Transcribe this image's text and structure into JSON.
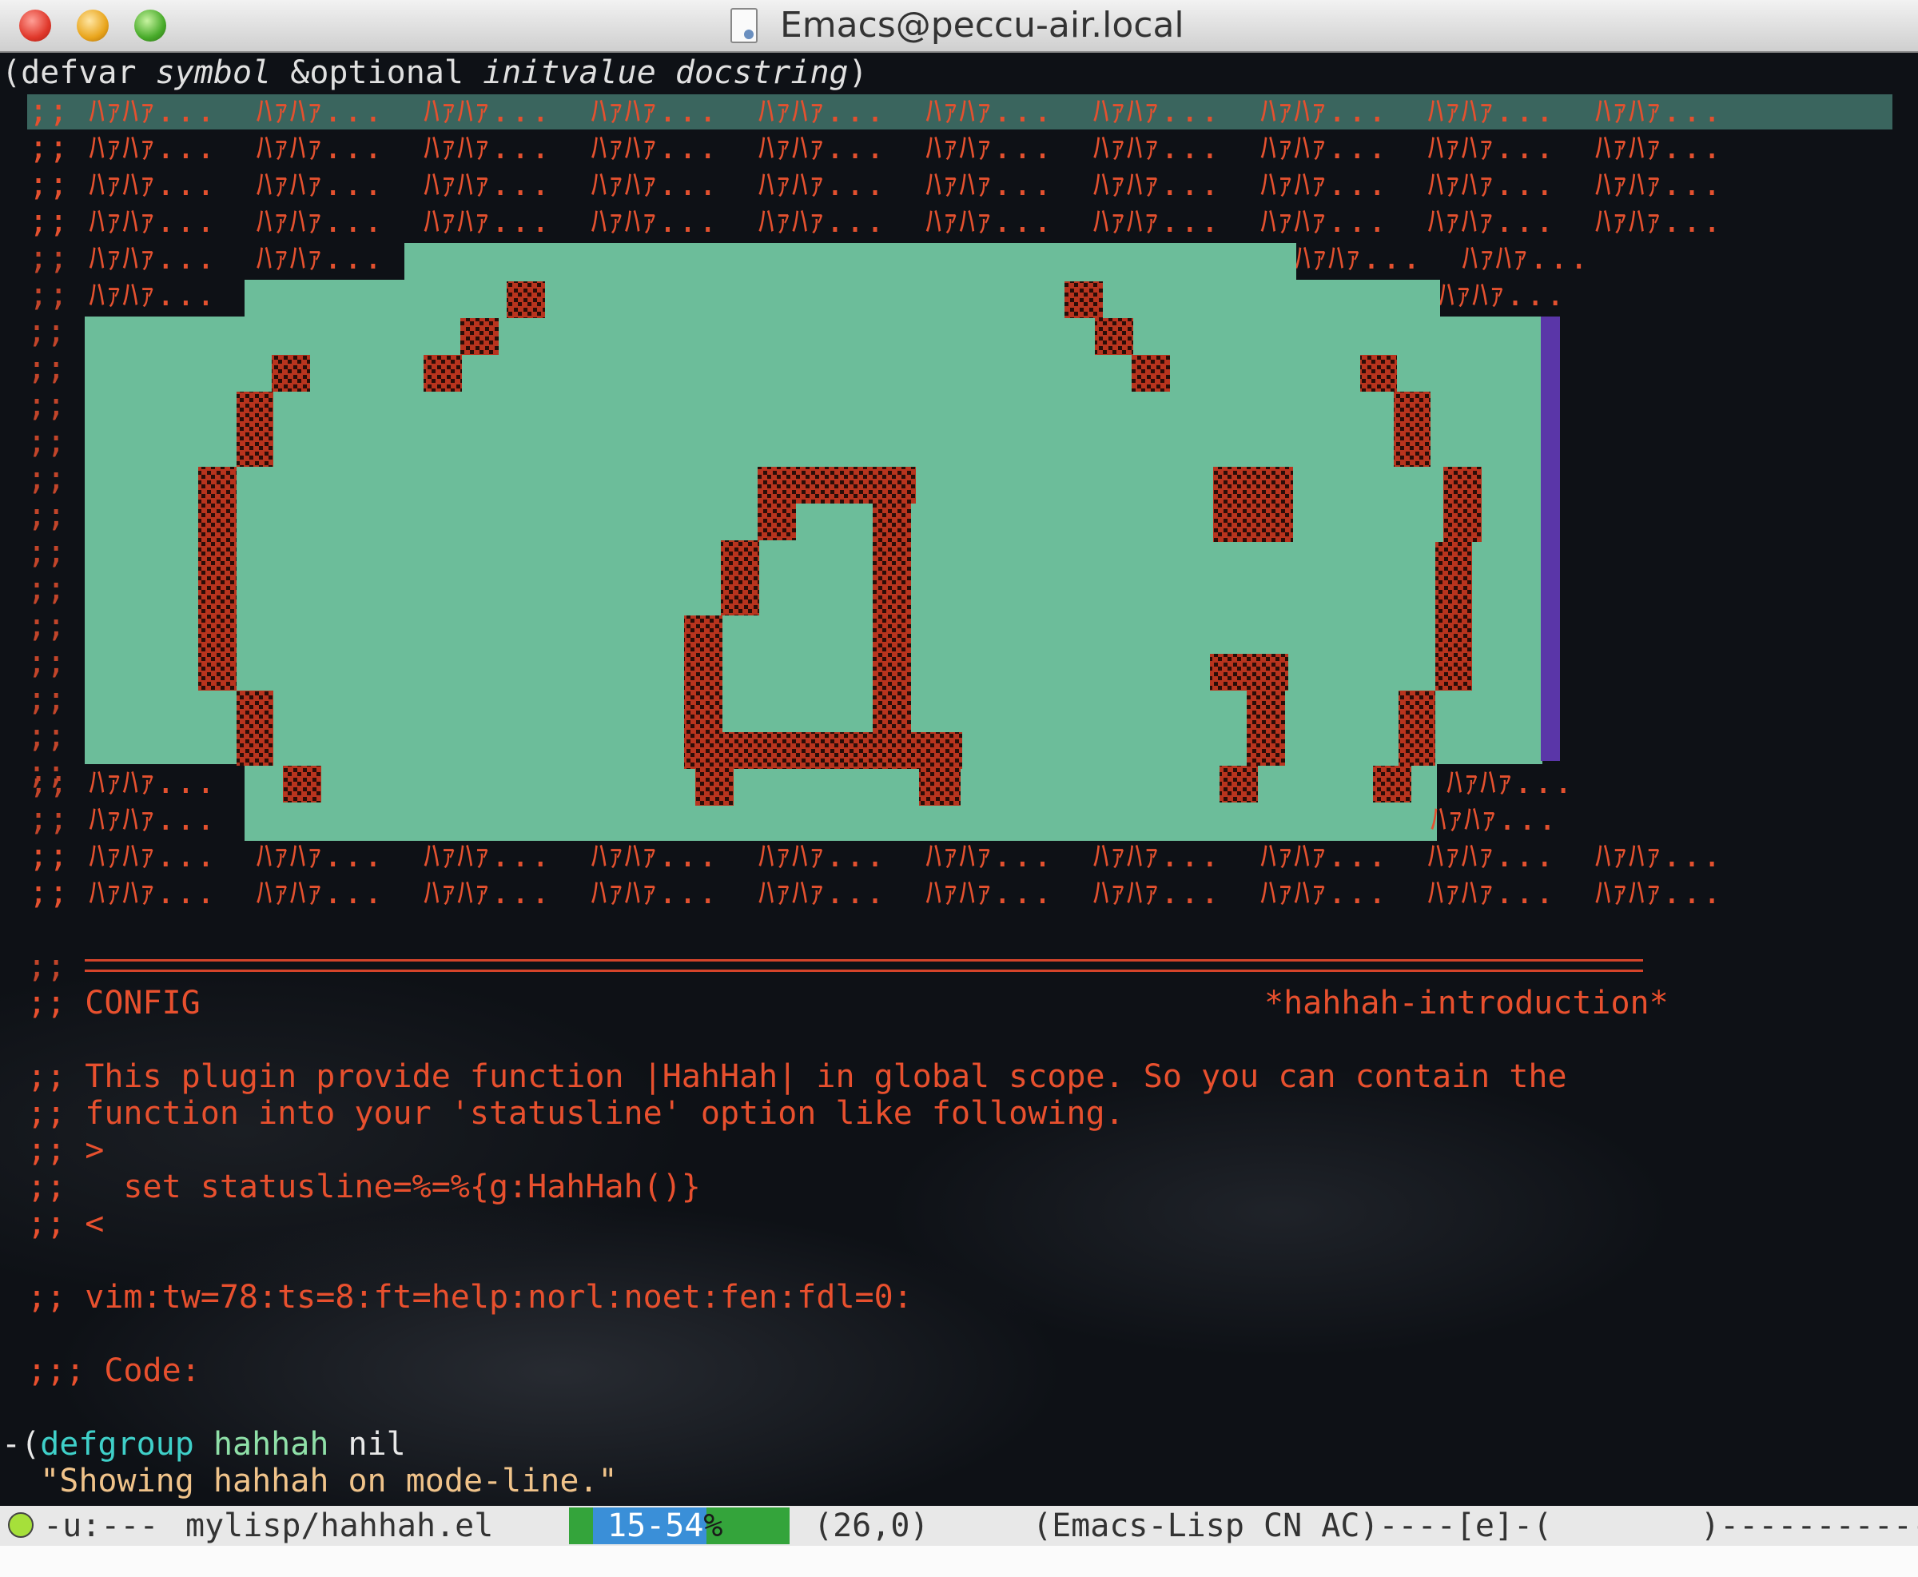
{
  "window": {
    "title": "Emacs@peccu-air.local"
  },
  "echo": {
    "prefix": "(defvar ",
    "arg1": "symbol",
    "mid": " &optional ",
    "arg2": "initvalue docstring",
    "suffix": ")"
  },
  "ascii_cell": "ﾊｧﾊｧ...",
  "ascii_rows": [
    ";; ﾊｧﾊｧ...  ﾊｧﾊｧ...  ﾊｧﾊｧ...  ﾊｧﾊｧ...  ﾊｧﾊｧ...  ﾊｧﾊｧ...  ﾊｧﾊｧ...  ﾊｧﾊｧ...  ﾊｧﾊｧ...  ﾊｧﾊｧ...",
    ";; ﾊｧﾊｧ...  ﾊｧﾊｧ...  ﾊｧﾊｧ...  ﾊｧﾊｧ...  ﾊｧﾊｧ...  ﾊｧﾊｧ...  ﾊｧﾊｧ...  ﾊｧﾊｧ...  ﾊｧﾊｧ...  ﾊｧﾊｧ...",
    ";; ﾊｧﾊｧ...  ﾊｧﾊｧ...  ﾊｧﾊｧ...  ﾊｧﾊｧ...  ﾊｧﾊｧ...  ﾊｧﾊｧ...  ﾊｧﾊｧ...  ﾊｧﾊｧ...  ﾊｧﾊｧ...  ﾊｧﾊｧ...",
    ";; ﾊｧﾊｧ...  ﾊｧﾊｧ...  ﾊｧﾊｧ...  ﾊｧﾊｧ...  ﾊｧﾊｧ...  ﾊｧﾊｧ...  ﾊｧﾊｧ...  ﾊｧﾊｧ...  ﾊｧﾊｧ...  ﾊｧﾊｧ..."
  ],
  "ascii_rows_bottom": [
    ";; ﾊｧﾊｧ...  ﾊｧﾊｧ...  ﾊｧﾊｧ...  ﾊｧﾊｧ...  ﾊｧﾊｧ...  ﾊｧﾊｧ...  ﾊｧﾊｧ...  ﾊｧﾊｧ...  ﾊｧﾊｧ...  ﾊｧﾊｧ...",
    ";; ﾊｧﾊｧ...  ﾊｧﾊｧ...  ﾊｧﾊｧ...  ﾊｧﾊｧ...  ﾊｧﾊｧ...  ﾊｧﾊｧ...  ﾊｧﾊｧ...  ﾊｧﾊｧ...  ﾊｧﾊｧ...  ﾊｧﾊｧ..."
  ],
  "side_left": [
    "ﾊｧﾊｧ...  ﾊｧﾊｧ...",
    "ﾊｧﾊｧ...",
    "ﾊｧﾊｧ...",
    "ﾊｧﾊｧ..."
  ],
  "side_right": [
    "ﾊｧﾊｧ...  ﾊｧﾊｧ...",
    "ﾊｧﾊｧ...",
    "ﾊｧﾊｧ...",
    "ﾊｧﾊｧ..."
  ],
  "comment_prefix": ";;",
  "config": {
    "label": "CONFIG",
    "tag": "*hahhah-introduction*"
  },
  "doc": {
    "line1": ";; This plugin provide function |HahHah| in global scope. So you can contain the",
    "line2": ";; function into your 'statusline' option like following.",
    "open": ";; >",
    "code": ";;   set statusline=%=%{g:HahHah()}",
    "close": ";; <"
  },
  "modeline_vim": ";; vim:tw=78:ts=8:ft=help:norl:noet:fen:fdl=0:",
  "code_header": ";;; Code:",
  "defgroup": {
    "dash": "-",
    "open": "(",
    "kw": "defgroup",
    "name": "hahhah",
    "rest": " nil",
    "doc": "  \"Showing hahhah on mode-line.\""
  },
  "status": {
    "flags": "-u:---",
    "file": "mylisp/hahhah.el",
    "position": "15-54",
    "percent": "%",
    "cursor": "(26,0)",
    "modes": "(Emacs-Lisp CN AC)----[e]-(",
    "tail": ")---------------"
  },
  "colors": {
    "accent": "#e8502e",
    "face_green": "#6fc39f",
    "face_purple": "#5a36a8"
  }
}
